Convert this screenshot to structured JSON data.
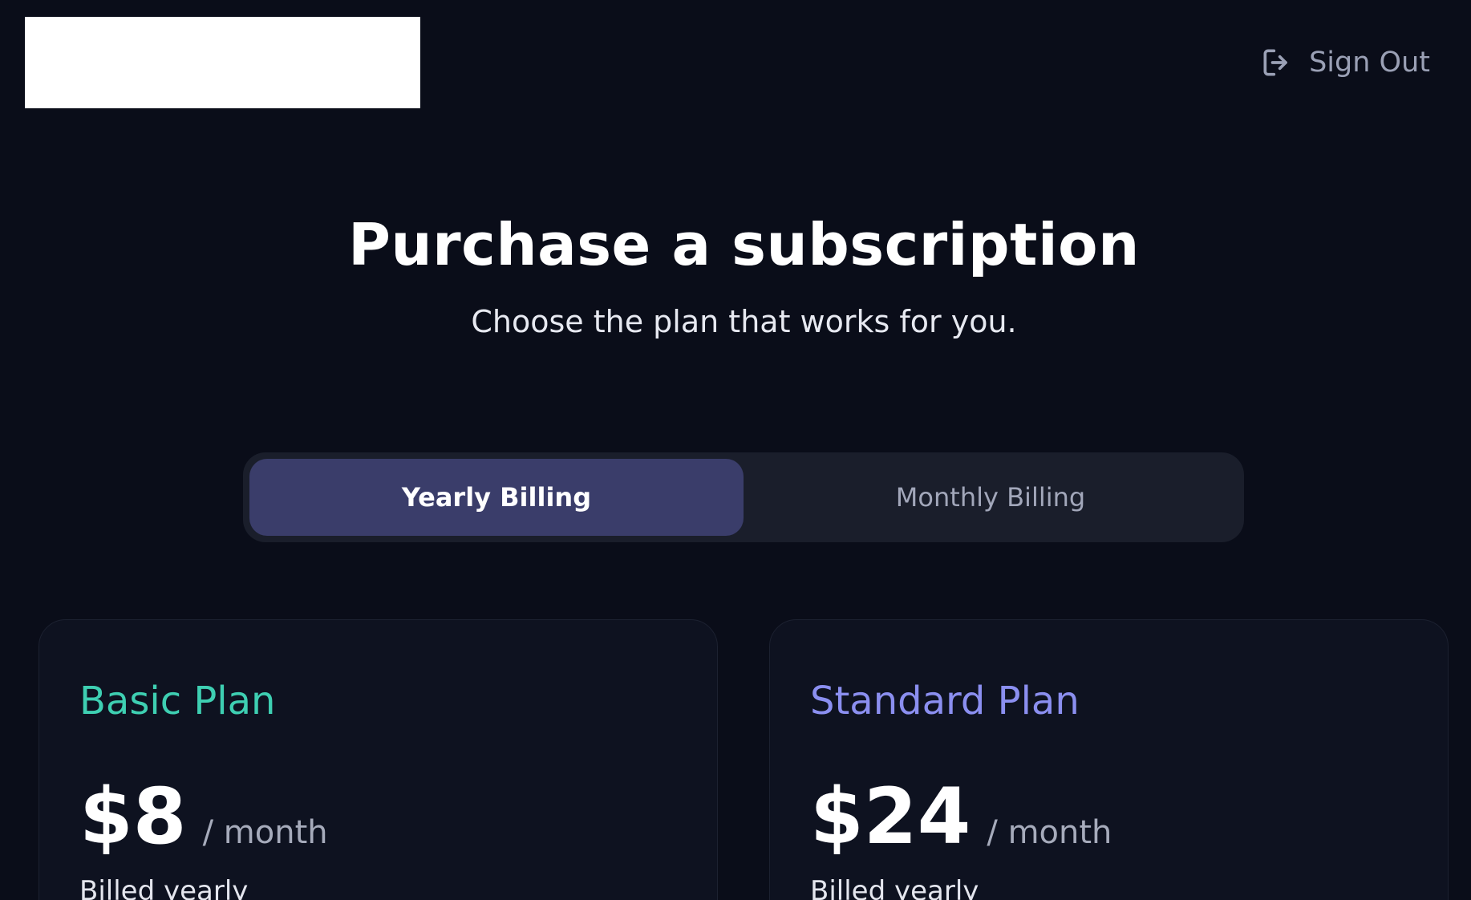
{
  "header": {
    "sign_out_label": "Sign Out",
    "sign_out_icon": "sign-out-icon"
  },
  "hero": {
    "title": "Purchase a subscription",
    "subtitle": "Choose the plan that works for you."
  },
  "billing_toggle": {
    "options": [
      {
        "label": "Yearly Billing",
        "selected": true
      },
      {
        "label": "Monthly Billing",
        "selected": false
      }
    ]
  },
  "plans": [
    {
      "name": "Basic Plan",
      "price": "$8",
      "period": "/ month",
      "billing_note": "Billed yearly",
      "accent_color": "#3ecfb2"
    },
    {
      "name": "Standard Plan",
      "price": "$24",
      "period": "/ month",
      "billing_note": "Billed yearly",
      "accent_color": "#8b8ff0"
    }
  ],
  "colors": {
    "background": "#0a0d19",
    "card_background": "#0e1220",
    "toggle_active": "#3a3d6a",
    "muted_text": "#9aa0b5"
  }
}
